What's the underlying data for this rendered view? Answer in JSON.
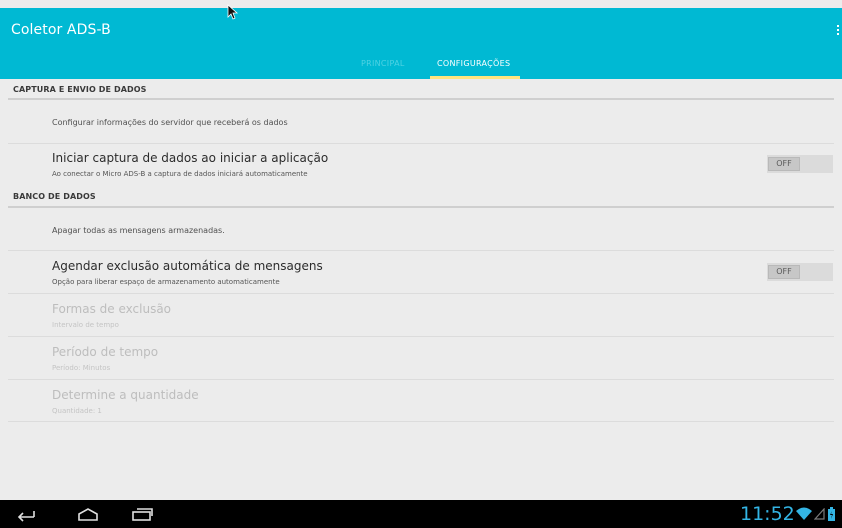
{
  "app": {
    "title": "Coletor ADS-B",
    "overflow_icon": "overflow-menu-icon"
  },
  "tabs": [
    {
      "label": "PRINCIPAL",
      "selected": false
    },
    {
      "label": "CONFIGURAÇÕES",
      "selected": true
    }
  ],
  "sections": {
    "capture": {
      "header": "CAPTURA E ENVIO DE DADOS",
      "server_config": "Configurar informações do servidor que receberá os dados",
      "auto_capture": {
        "title": "Iniciar captura de dados ao iniciar a aplicação",
        "summary": "Ao conectar o Micro ADS-B a captura de dados iniciará automaticamente",
        "toggle": "OFF"
      }
    },
    "database": {
      "header": "BANCO DE DADOS",
      "delete_all": "Apagar todas as mensagens armazenadas.",
      "auto_delete": {
        "title": "Agendar exclusão automática de mensagens",
        "summary": "Opção para liberar espaço de armazenamento automaticamente",
        "toggle": "OFF"
      },
      "delete_mode": {
        "title": "Formas de exclusão",
        "summary": "Intervalo de tempo"
      },
      "time_period": {
        "title": "Período de tempo",
        "summary": "Período: Minutos"
      },
      "quantity": {
        "title": "Determine a quantidade",
        "summary": "Quantidade: 1"
      }
    }
  },
  "status": {
    "time": "11:52"
  },
  "colors": {
    "accent": "#00b9d3",
    "tab_indicator": "#ffe57f",
    "clock": "#33b5e5"
  }
}
